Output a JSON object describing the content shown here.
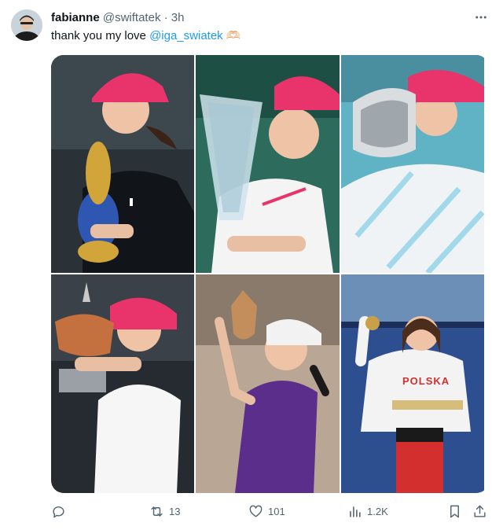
{
  "author": {
    "name": "fabianne",
    "handle": "@swiftatek",
    "separator": "·",
    "time": "3h"
  },
  "tweet": {
    "text_prefix": "thank you my love ",
    "mention": "@iga_swiatek",
    "emoji": "🫶🏻"
  },
  "photos": [
    {
      "alt": "Kissing trophy in black jacket and pink cap"
    },
    {
      "alt": "Smiling with glass trophy in white top"
    },
    {
      "alt": "Kissing silver trophy in white top"
    },
    {
      "alt": "Kissing trophy in white tank top"
    },
    {
      "alt": "Lifting trophy in purple top and white cap"
    },
    {
      "alt": "Holding medal in POLSKA jacket"
    }
  ],
  "jacket_text": "POLSKA",
  "actions": {
    "reply_count": "",
    "retweet_count": "13",
    "like_count": "101",
    "views_count": "1.2K"
  },
  "colors": {
    "accent": "#1d9bf0",
    "text_secondary": "#536471",
    "cap_pink": "#e8336b"
  }
}
